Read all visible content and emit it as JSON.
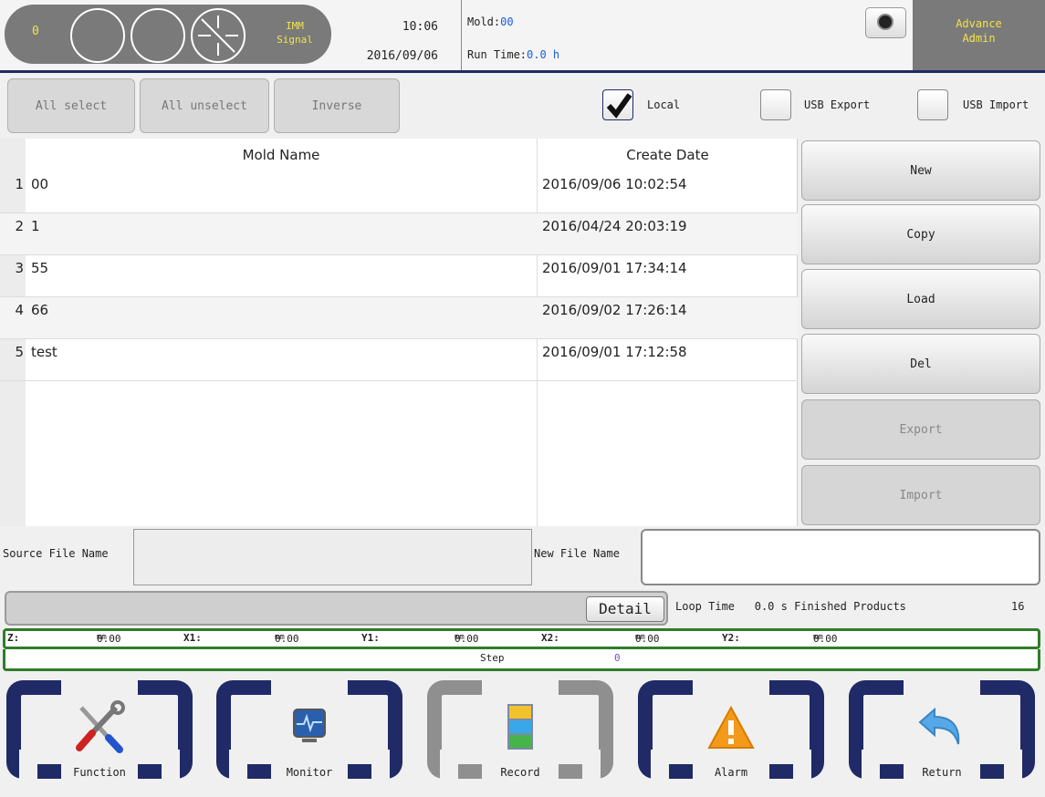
{
  "header": {
    "counter": "0",
    "signal_label_1": "IMM",
    "signal_label_2": "Signal",
    "time": "10:06",
    "date": "2016/09/06",
    "mold_label": "Mold:",
    "mold_value": "00",
    "runtime_label": "Run Time:",
    "runtime_value": "0.0 h",
    "user_line1": "Advance",
    "user_line2": "Admin"
  },
  "toolbar": {
    "all_select": "All select",
    "all_unselect": "All unselect",
    "inverse": "Inverse",
    "local_label": "Local",
    "local_checked": true,
    "usb_export_label": "USB Export",
    "usb_import_label": "USB Import"
  },
  "table": {
    "columns": [
      "Mold Name",
      "Create Date"
    ],
    "rows": [
      {
        "num": "1",
        "name": "00",
        "date": "2016/09/06 10:02:54"
      },
      {
        "num": "2",
        "name": "1",
        "date": "2016/04/24 20:03:19"
      },
      {
        "num": "3",
        "name": "55",
        "date": "2016/09/01 17:34:14"
      },
      {
        "num": "4",
        "name": "66",
        "date": "2016/09/02 17:26:14"
      },
      {
        "num": "5",
        "name": "test",
        "date": "2016/09/01 17:12:58"
      }
    ]
  },
  "actions": {
    "new": "New",
    "copy": "Copy",
    "load": "Load",
    "del": "Del",
    "export": "Export",
    "import": "Import"
  },
  "files": {
    "source_label": "Source File Name",
    "source_value": "",
    "new_label": "New File Name",
    "new_value": ""
  },
  "status": {
    "detail": "Detail",
    "loop_label": "Loop Time",
    "loop_value": "0.0 s",
    "products_label": "Finished Products",
    "products_value": "16"
  },
  "axes": [
    {
      "name": "Z:",
      "value": "0.00",
      "unit": "mm"
    },
    {
      "name": "X1:",
      "value": "0.00",
      "unit": "mm"
    },
    {
      "name": "Y1:",
      "value": "0.00",
      "unit": "mm"
    },
    {
      "name": "X2:",
      "value": "0.00",
      "unit": "mm"
    },
    {
      "name": "Y2:",
      "value": "0.00",
      "unit": "mm"
    }
  ],
  "step": {
    "label": "Step",
    "value": "0"
  },
  "nav": {
    "function": "Function",
    "monitor": "Monitor",
    "record": "Record",
    "alarm": "Alarm",
    "return": "Return"
  },
  "colors": {
    "accent_navy": "#1f2a66",
    "value_blue": "#1a5de0",
    "signal_yellow": "#f2e24a",
    "axis_border_green": "#2f7d2a"
  }
}
